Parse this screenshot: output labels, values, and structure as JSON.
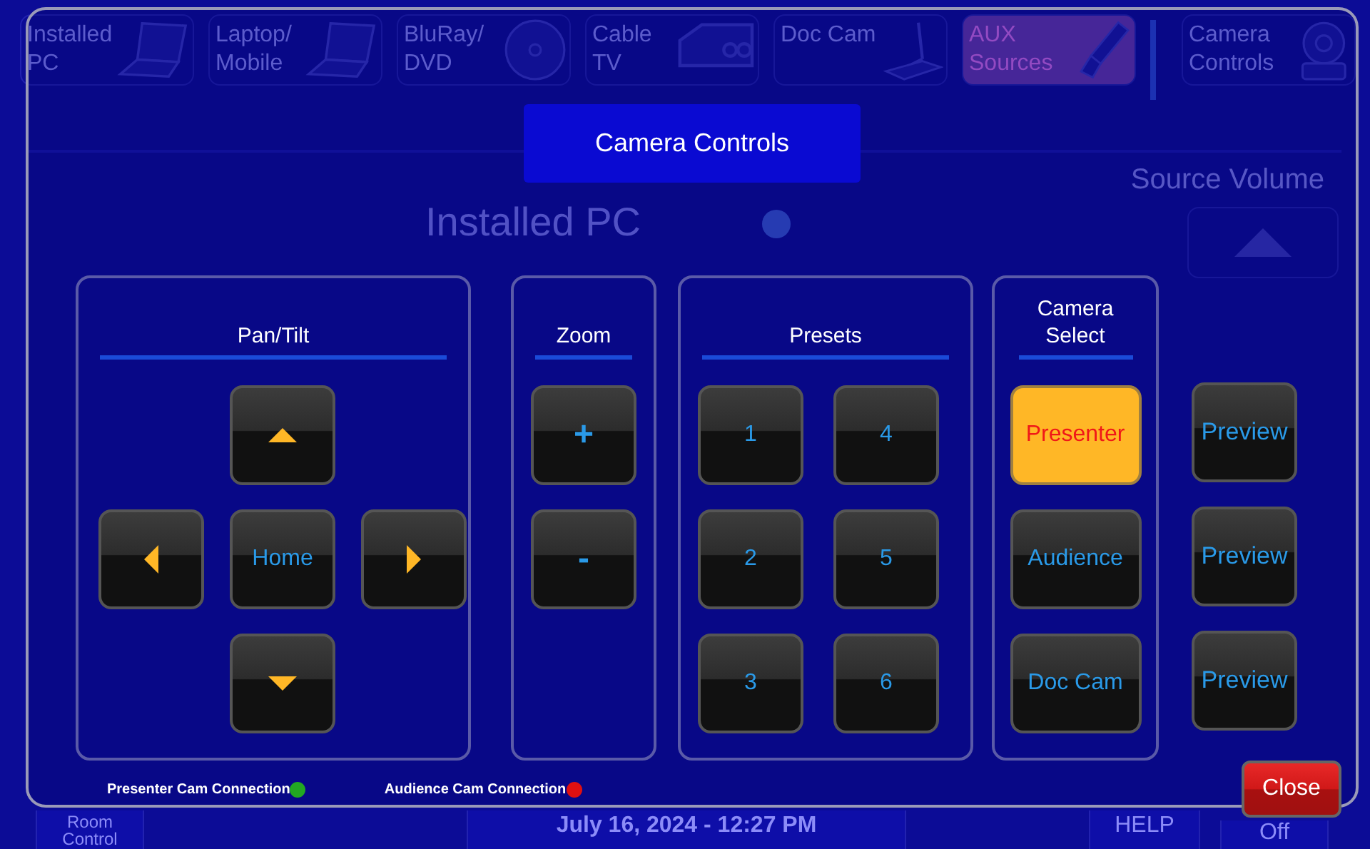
{
  "background": {
    "sources": [
      {
        "label": "Installed PC",
        "kind": "laptop",
        "selected": false
      },
      {
        "label": "Laptop/ Mobile",
        "kind": "laptop",
        "selected": false
      },
      {
        "label": "BluRay/ DVD",
        "kind": "disc",
        "selected": false
      },
      {
        "label": "Cable TV",
        "kind": "settop",
        "selected": false
      },
      {
        "label": "Doc Cam",
        "kind": "doccam",
        "selected": false
      },
      {
        "label": "AUX Sources",
        "kind": "plug",
        "selected": true
      }
    ],
    "camera_tab": {
      "label": "Camera Controls"
    },
    "current_source": "Installed PC",
    "source_volume": {
      "label": "Source Volume"
    },
    "footer": {
      "room_control": "Room Control",
      "datetime": "July 16, 2024  -  12:27 PM",
      "help": "HELP",
      "power": "Off"
    }
  },
  "dialog": {
    "title": "Camera Controls",
    "pan_tilt": {
      "title": "Pan/Tilt",
      "home": "Home"
    },
    "zoom": {
      "title": "Zoom",
      "buttons": [
        "+",
        "-"
      ]
    },
    "presets": {
      "title": "Presets",
      "buttons": [
        "1",
        "4",
        "2",
        "5",
        "3",
        "6"
      ]
    },
    "camera_select": {
      "title": "Camera Select",
      "cameras": [
        {
          "label": "Presenter",
          "selected": true
        },
        {
          "label": "Audience",
          "selected": false
        },
        {
          "label": "Doc Cam",
          "selected": false
        }
      ]
    },
    "preview_buttons": [
      "Preview",
      "Preview",
      "Preview"
    ],
    "connections": [
      {
        "label": "Presenter Cam Connection",
        "color": "#22a822"
      },
      {
        "label": "Audience Cam Connection",
        "color": "#e01010"
      }
    ],
    "close": "Close"
  }
}
